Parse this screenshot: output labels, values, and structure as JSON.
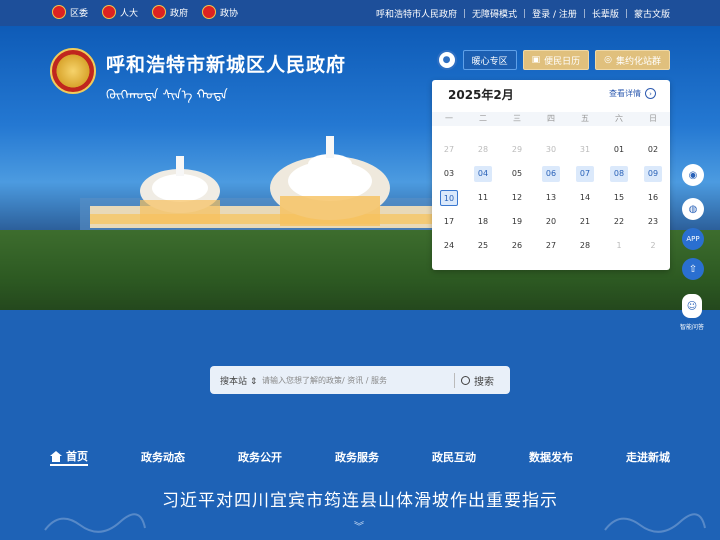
{
  "topbar": {
    "left_links": [
      "区委",
      "人大",
      "政府",
      "政协"
    ],
    "right_links": [
      "呼和浩特市人民政府",
      "无障碍模式",
      "登录 / 注册",
      "长辈版",
      "蒙古文版"
    ]
  },
  "header": {
    "title": "呼和浩特市新城区人民政府",
    "mongolian_title": "ᠬᠥᠬᠡᠬᠣᠲᠠ ᠰᠢᠨ᠎ᠡ ᠬᠣᠲᠠ",
    "buttons": [
      "暖心专区",
      "便民日历",
      "集约化站群"
    ]
  },
  "calendar": {
    "title": "2025年2月",
    "more_label": "查看详情",
    "weekdays": [
      "一",
      "二",
      "三",
      "四",
      "五",
      "六",
      "日"
    ],
    "days": [
      {
        "d": "27",
        "s": "other"
      },
      {
        "d": "28",
        "s": "other"
      },
      {
        "d": "29",
        "s": "other"
      },
      {
        "d": "30",
        "s": "other"
      },
      {
        "d": "31",
        "s": "other"
      },
      {
        "d": "01",
        "s": ""
      },
      {
        "d": "02",
        "s": ""
      },
      {
        "d": "03",
        "s": ""
      },
      {
        "d": "04",
        "s": "hl"
      },
      {
        "d": "05",
        "s": ""
      },
      {
        "d": "06",
        "s": "hl"
      },
      {
        "d": "07",
        "s": "hl"
      },
      {
        "d": "08",
        "s": "hl"
      },
      {
        "d": "09",
        "s": "hl"
      },
      {
        "d": "10",
        "s": "today"
      },
      {
        "d": "11",
        "s": ""
      },
      {
        "d": "12",
        "s": ""
      },
      {
        "d": "13",
        "s": ""
      },
      {
        "d": "14",
        "s": ""
      },
      {
        "d": "15",
        "s": ""
      },
      {
        "d": "16",
        "s": ""
      },
      {
        "d": "17",
        "s": ""
      },
      {
        "d": "18",
        "s": ""
      },
      {
        "d": "19",
        "s": ""
      },
      {
        "d": "20",
        "s": ""
      },
      {
        "d": "21",
        "s": ""
      },
      {
        "d": "22",
        "s": ""
      },
      {
        "d": "23",
        "s": ""
      },
      {
        "d": "24",
        "s": ""
      },
      {
        "d": "25",
        "s": ""
      },
      {
        "d": "26",
        "s": ""
      },
      {
        "d": "27",
        "s": ""
      },
      {
        "d": "28",
        "s": ""
      },
      {
        "d": "1",
        "s": "other"
      },
      {
        "d": "2",
        "s": "other"
      }
    ]
  },
  "floating": {
    "app_label": "APP",
    "robot_label": "智能问答"
  },
  "search": {
    "scope": "搜本站",
    "placeholder": "请输入您想了解的政策/ 资讯 / 服务",
    "button": "搜索"
  },
  "nav": [
    "首页",
    "政务动态",
    "政务公开",
    "政务服务",
    "政民互动",
    "数据发布",
    "走进新城"
  ],
  "headline": "习近平对四川宜宾市筠连县山体滑坡作出重要指示",
  "colors": {
    "primary_blue": "#1e62b6",
    "topbar_blue": "#1d4f9a",
    "gold_button": "#e0c07d",
    "calendar_highlight": "#dbe9fb"
  }
}
